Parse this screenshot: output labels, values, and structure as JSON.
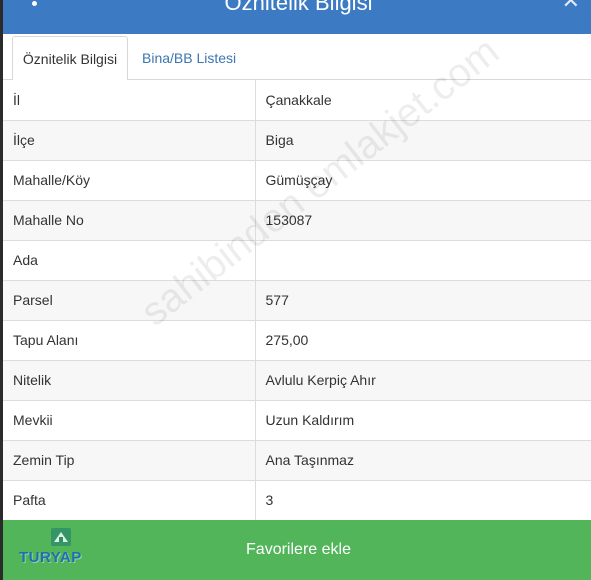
{
  "header": {
    "title": "Öznitelik Bilgisi",
    "menu_icon": "vertical-dots-icon",
    "close_icon": "close-icon"
  },
  "tabs": [
    {
      "label": "Öznitelik Bilgisi",
      "active": true
    },
    {
      "label": "Bina/BB Listesi",
      "active": false
    }
  ],
  "attributes": [
    {
      "key": "İl",
      "value": "Çanakkale"
    },
    {
      "key": "İlçe",
      "value": "Biga"
    },
    {
      "key": "Mahalle/Köy",
      "value": "Gümüşçay"
    },
    {
      "key": "Mahalle No",
      "value": "153087"
    },
    {
      "key": "Ada",
      "value": ""
    },
    {
      "key": "Parsel",
      "value": "577"
    },
    {
      "key": "Tapu Alanı",
      "value": "275,00"
    },
    {
      "key": "Nitelik",
      "value": "Avlulu Kerpiç Ahır"
    },
    {
      "key": "Mevkii",
      "value": "Uzun Kaldırım"
    },
    {
      "key": "Zemin Tip",
      "value": "Ana Taşınmaz"
    },
    {
      "key": "Pafta",
      "value": "3"
    }
  ],
  "watermark": "sahibinden emlakjet.com",
  "footer": {
    "button_label": "Favorilere ekle",
    "logo_text": "TURYAP"
  },
  "colors": {
    "header": "#3c7bc4",
    "button": "#52b55a",
    "tab_link": "#3c76b0"
  }
}
